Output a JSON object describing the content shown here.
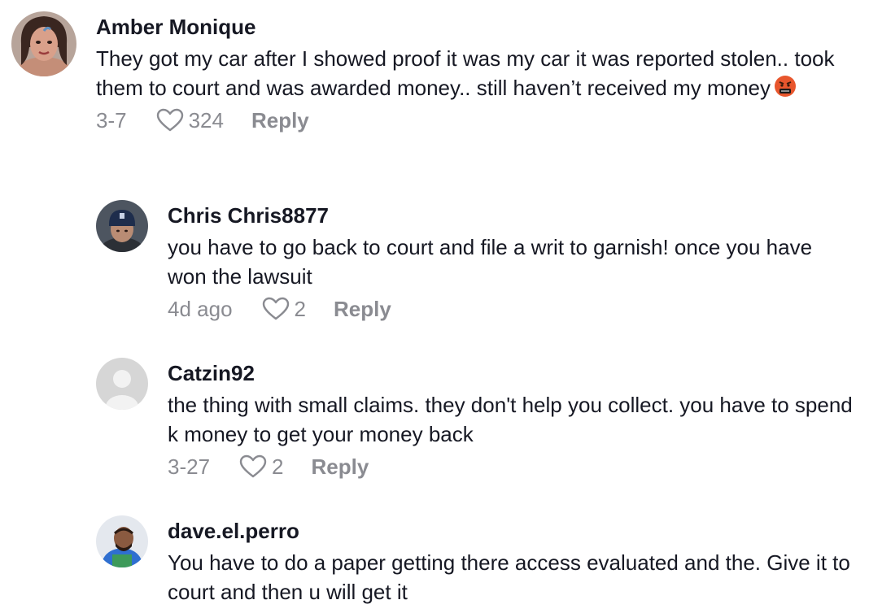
{
  "comments": [
    {
      "username": "Amber Monique",
      "text": "They got my car after I showed proof it was my car it was reported stolen.. took them to court and was awarded money.. still haven’t received my money",
      "emoji": "angry-cursing-face-emoji",
      "date": "3-7",
      "likes": "324",
      "reply_label": "Reply"
    },
    {
      "username": "Chris Chris8877",
      "text": "you have to go back to court and file a writ to garnish! once you have won the lawsuit",
      "date": "4d ago",
      "likes": "2",
      "reply_label": "Reply"
    },
    {
      "username": "Catzin92",
      "text": "the thing with small claims. they don't help you collect. you have to spend k money to get your money back",
      "date": "3-27",
      "likes": "2",
      "reply_label": "Reply"
    },
    {
      "username": "dave.el.perro",
      "text": "You have to do a paper getting there access evaluated and the. Give it to court and then u will get it"
    }
  ],
  "colors": {
    "text": "#161823",
    "meta": "#8a8b91",
    "background": "#ffffff"
  },
  "icons": {
    "like": "heart-outline-icon",
    "default_avatar": "default-user-avatar-icon"
  }
}
